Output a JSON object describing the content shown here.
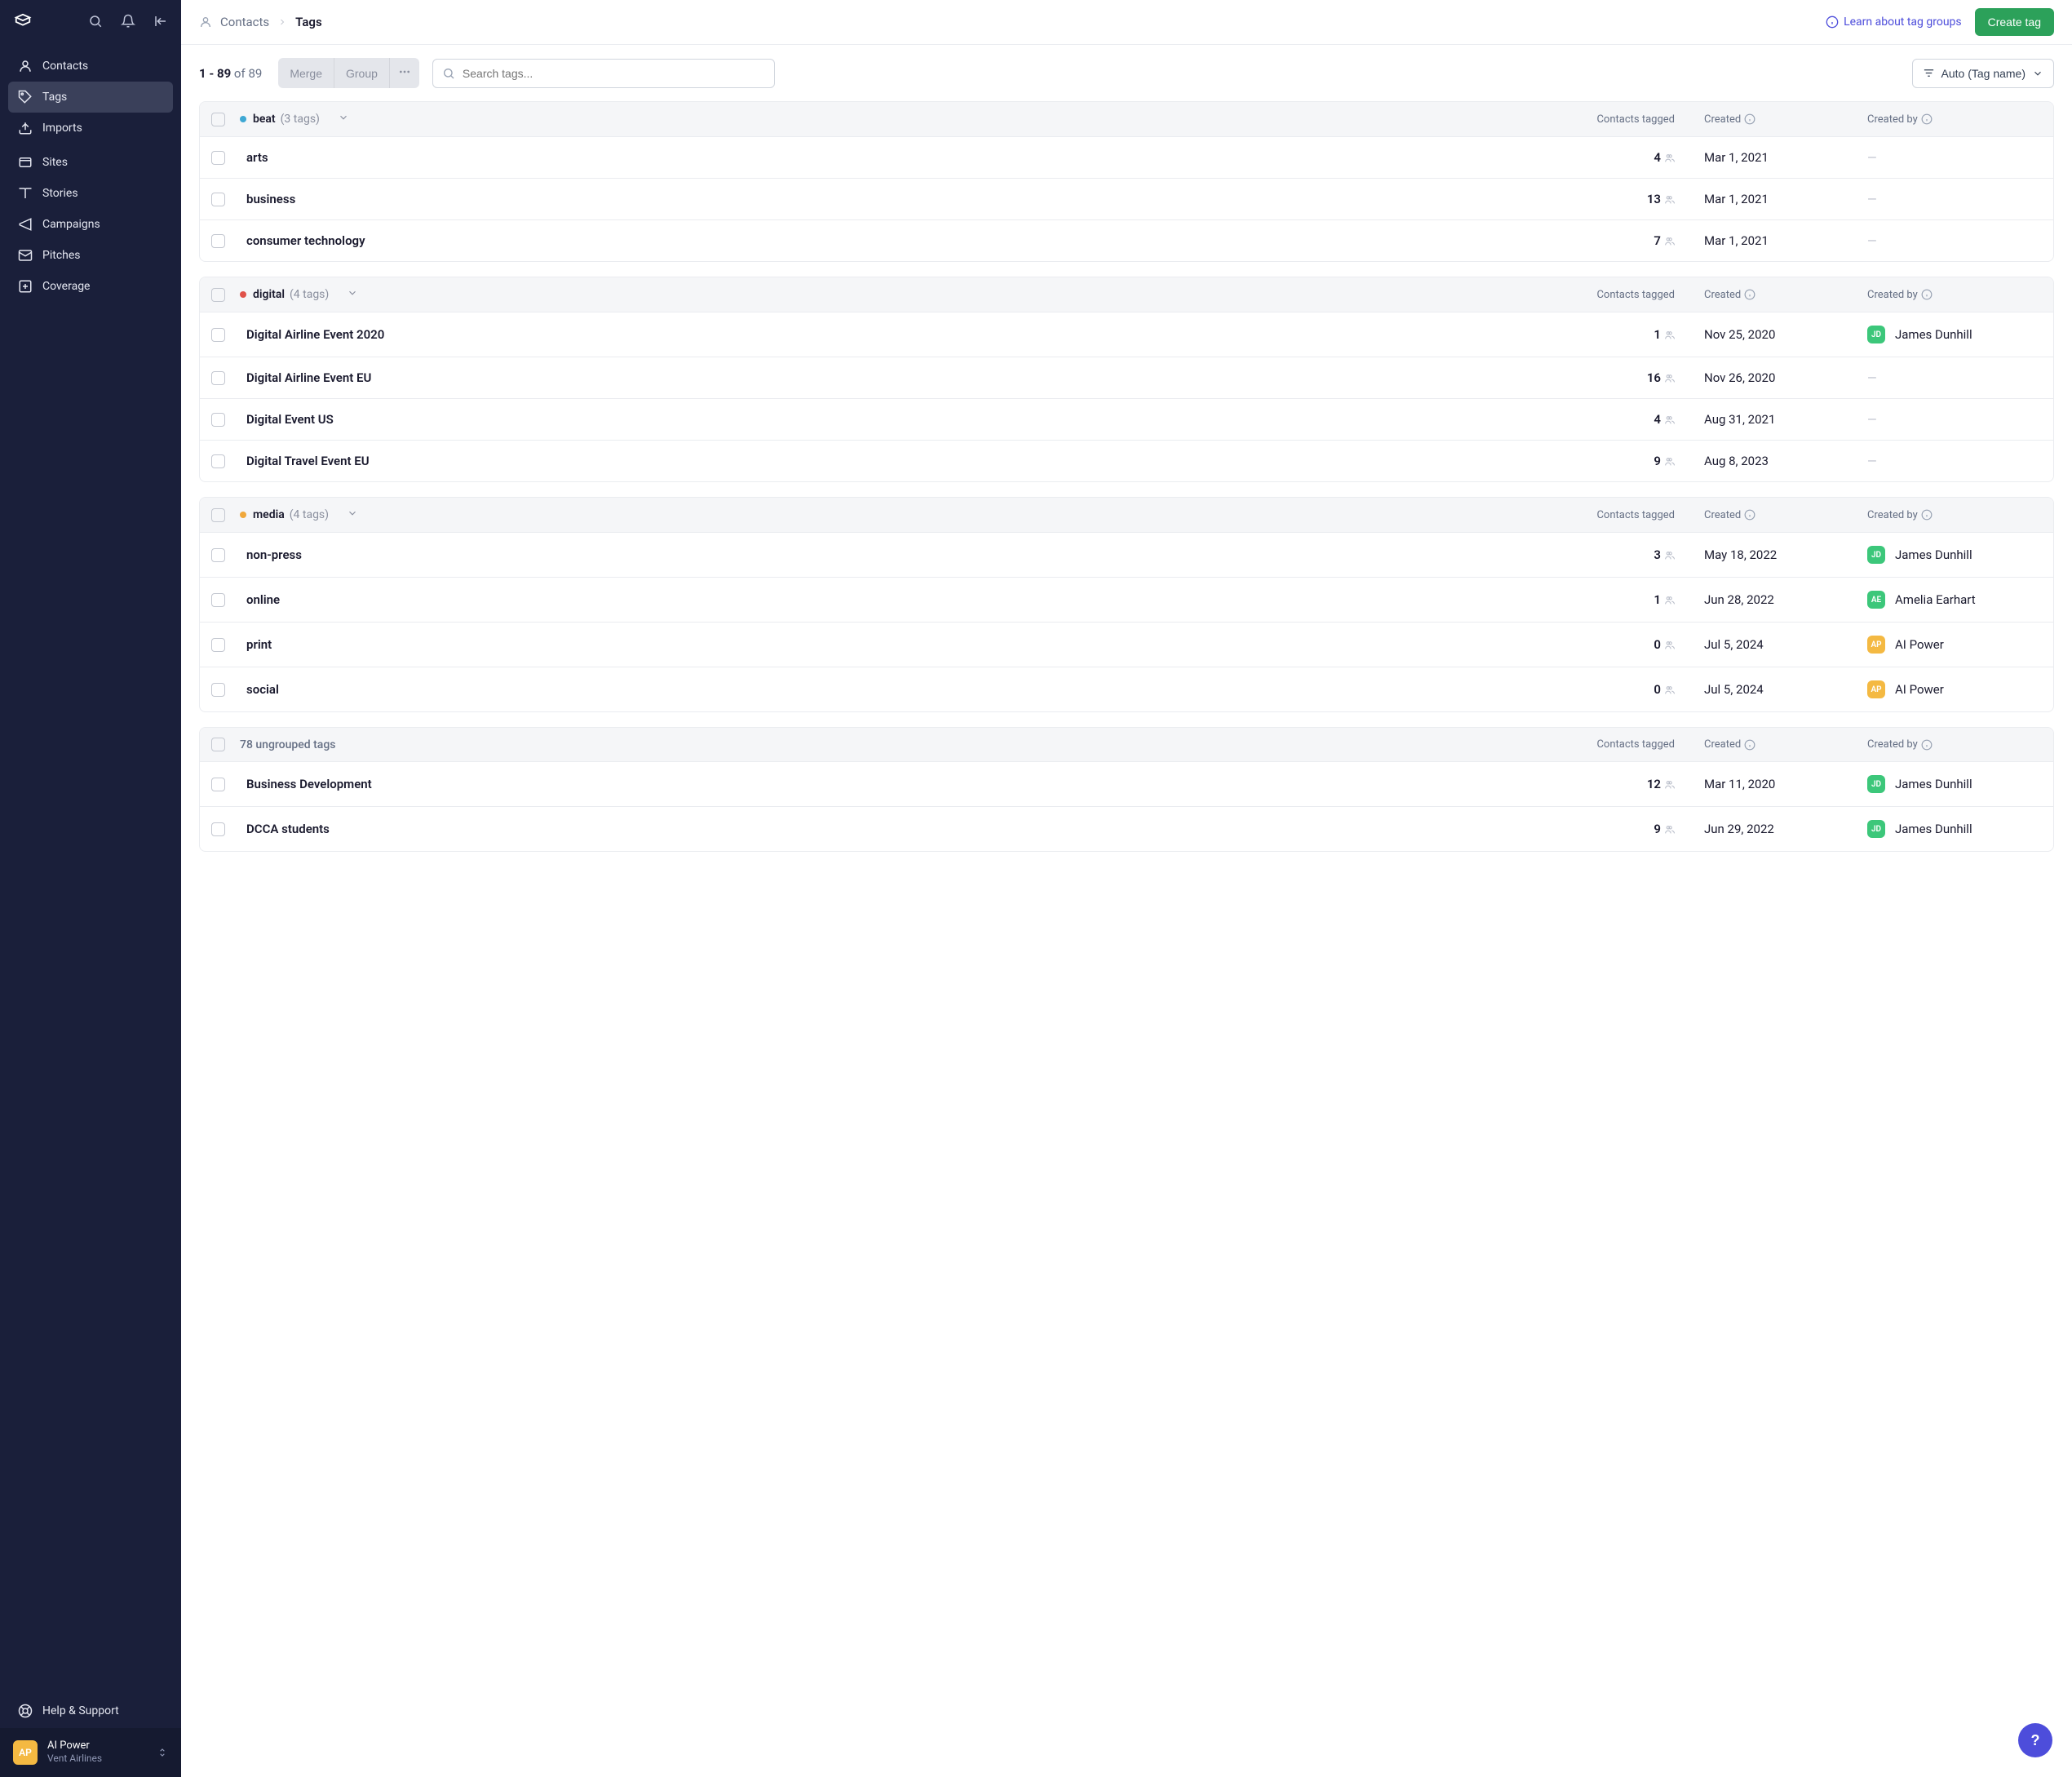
{
  "sidebar": {
    "nav": {
      "contacts": "Contacts",
      "tags": "Tags",
      "imports": "Imports",
      "sites": "Sites",
      "stories": "Stories",
      "campaigns": "Campaigns",
      "pitches": "Pitches",
      "coverage": "Coverage"
    },
    "help": "Help & Support",
    "user": {
      "initials": "AP",
      "name": "AI Power",
      "org": "Vent Airlines"
    }
  },
  "breadcrumb": {
    "parent": "Contacts",
    "current": "Tags"
  },
  "topbar": {
    "learn": "Learn about tag groups",
    "create": "Create tag"
  },
  "toolbar": {
    "range": "1 - 89",
    "of": "of",
    "total": "89",
    "merge": "Merge",
    "group": "Group",
    "search_placeholder": "Search tags...",
    "sort": "Auto (Tag name)"
  },
  "columns": {
    "contacts": "Contacts tagged",
    "created": "Created",
    "author": "Created by"
  },
  "groups": [
    {
      "name": "beat",
      "color": "#3ea8d4",
      "count_label": "(3 tags)",
      "rows": [
        {
          "name": "arts",
          "contacts": "4",
          "created": "Mar 1, 2021",
          "author": null
        },
        {
          "name": "business",
          "contacts": "13",
          "created": "Mar 1, 2021",
          "author": null
        },
        {
          "name": "consumer technology",
          "contacts": "7",
          "created": "Mar 1, 2021",
          "author": null
        }
      ]
    },
    {
      "name": "digital",
      "color": "#e0524a",
      "count_label": "(4 tags)",
      "rows": [
        {
          "name": "Digital Airline Event 2020",
          "contacts": "1",
          "created": "Nov 25, 2020",
          "author": {
            "initials": "JD",
            "name": "James Dunhill",
            "cls": "jd"
          }
        },
        {
          "name": "Digital Airline Event EU",
          "contacts": "16",
          "created": "Nov 26, 2020",
          "author": null
        },
        {
          "name": "Digital Event US",
          "contacts": "4",
          "created": "Aug 31, 2021",
          "author": null
        },
        {
          "name": "Digital Travel Event EU",
          "contacts": "9",
          "created": "Aug 8, 2023",
          "author": null
        }
      ]
    },
    {
      "name": "media",
      "color": "#f0a83c",
      "count_label": "(4 tags)",
      "rows": [
        {
          "name": "non-press",
          "contacts": "3",
          "created": "May 18, 2022",
          "author": {
            "initials": "JD",
            "name": "James Dunhill",
            "cls": "jd"
          }
        },
        {
          "name": "online",
          "contacts": "1",
          "created": "Jun 28, 2022",
          "author": {
            "initials": "AE",
            "name": "Amelia Earhart",
            "cls": "ae"
          }
        },
        {
          "name": "print",
          "contacts": "0",
          "created": "Jul 5, 2024",
          "author": {
            "initials": "AP",
            "name": "AI Power",
            "cls": "ap"
          }
        },
        {
          "name": "social",
          "contacts": "0",
          "created": "Jul 5, 2024",
          "author": {
            "initials": "AP",
            "name": "AI Power",
            "cls": "ap"
          }
        }
      ]
    }
  ],
  "ungrouped": {
    "label": "78 ungrouped tags",
    "rows": [
      {
        "name": "Business Development",
        "contacts": "12",
        "created": "Mar 11, 2020",
        "author": {
          "initials": "JD",
          "name": "James Dunhill",
          "cls": "jd"
        }
      },
      {
        "name": "DCCA students",
        "contacts": "9",
        "created": "Jun 29, 2022",
        "author": {
          "initials": "JD",
          "name": "James Dunhill",
          "cls": "jd"
        }
      }
    ]
  },
  "fab": "?"
}
